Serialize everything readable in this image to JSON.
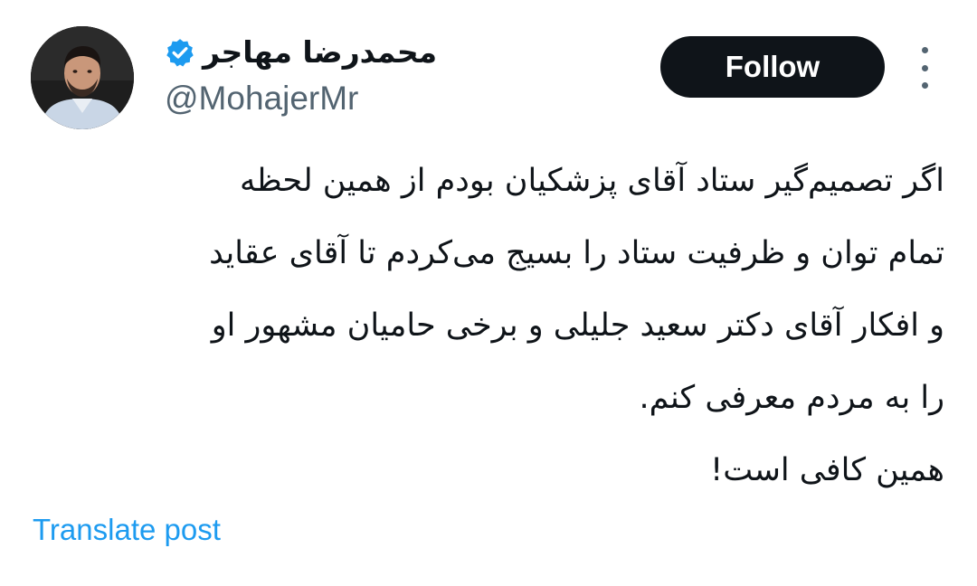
{
  "author": {
    "display_name": "محمدرضا مهاجر",
    "handle": "@MohajerMr",
    "verified_icon": "verified-badge-icon",
    "verified_color": "#1d9bf0"
  },
  "actions": {
    "follow_label": "Follow",
    "more_icon": "more-vertical-icon"
  },
  "tweet": {
    "lines": [
      "اگر تصمیم‌گیر ستاد آقای پزشکیان بودم از همین لحظه",
      "تمام توان و ظرفیت ستاد را بسیج می‌کردم تا آقای عقاید",
      "و افکار آقای دکتر سعید جلیلی و برخی حامیان مشهور او",
      "را به مردم معرفی کنم.",
      "همین کافی است!"
    ]
  },
  "footer": {
    "translate_label": "Translate post",
    "link_color": "#1d9bf0"
  }
}
